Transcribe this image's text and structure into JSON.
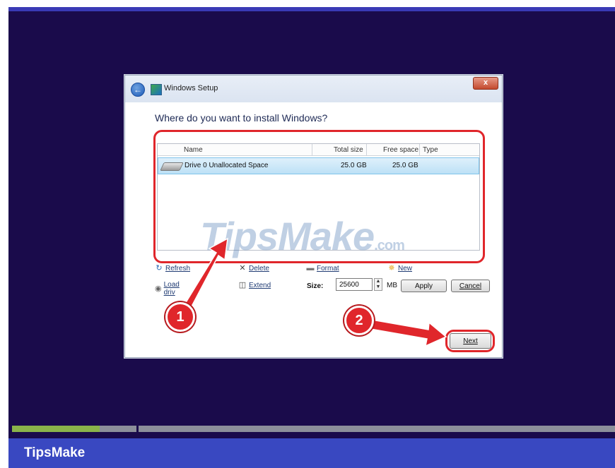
{
  "footer": {
    "brand": "TipsMake"
  },
  "progress": {
    "fraction": 0.145
  },
  "dialog": {
    "title": "Windows Setup",
    "close_symbol": "x",
    "back_icon": "back-arrow-icon",
    "heading": "Where do you want to install Windows?",
    "table": {
      "columns": [
        "Name",
        "Total size",
        "Free space",
        "Type"
      ],
      "rows": [
        {
          "name": "Drive 0 Unallocated Space",
          "total": "25.0 GB",
          "free": "25.0 GB",
          "type": ""
        }
      ]
    },
    "actions": {
      "refresh": "Refresh",
      "delete": "Delete",
      "format": "Format",
      "new": "New",
      "load_driver": "Load driv",
      "extend": "Extend"
    },
    "size": {
      "label": "Size:",
      "value": "25600",
      "unit": "MB"
    },
    "buttons": {
      "apply": "Apply",
      "cancel": "Cancel",
      "next": "Next"
    }
  },
  "annotations": {
    "step1": "1",
    "step2": "2",
    "accent": "#e0262b"
  },
  "watermark": {
    "text": "TipsMake",
    "suffix": ".com"
  }
}
